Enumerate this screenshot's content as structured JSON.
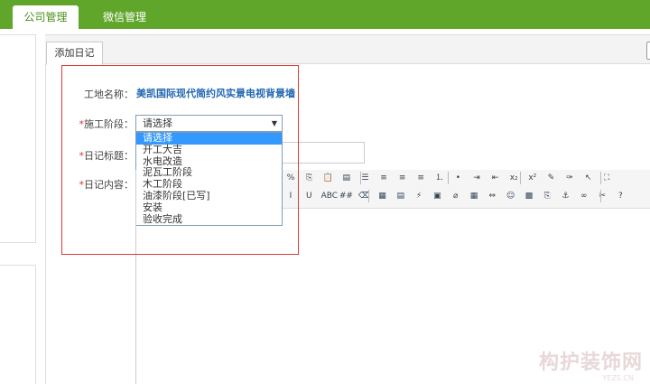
{
  "topnav": {
    "tab1": "公司管理",
    "tab2": "微信管理"
  },
  "subtab": "添加日记",
  "form": {
    "site_label": "工地名称：",
    "site_value": "美凯国际现代简约风实景电视背景墙",
    "stage_label": "施工阶段：",
    "title_label": "日记标题：",
    "content_label": "日记内容：",
    "required_mark": "*",
    "stage_selected": "请选择",
    "stage_options": [
      "请选择",
      "开工大吉",
      "水电改造",
      "泥瓦工阶段",
      "木工阶段",
      "油漆阶段[已写]",
      "安装",
      "验收完成"
    ]
  },
  "toolbar_icons": {
    "row1": [
      "copy-icon",
      "paste-icon",
      "paste-text-icon",
      "paste-word-icon",
      "align-left-icon",
      "align-center-icon",
      "align-right-icon",
      "justify-icon",
      "ordered-list-icon",
      "unordered-list-icon",
      "indent-icon",
      "outdent-icon",
      "subscript-icon",
      "superscript-icon",
      "clear-format-icon",
      "select-all-icon",
      "cursor-icon",
      "fullscreen-icon"
    ],
    "row2": [
      "italic-icon",
      "underline-icon",
      "strikethrough-icon",
      "hr-icon",
      "eraser-icon",
      "insert-image-icon",
      "insert-table-icon",
      "flash-icon",
      "media-icon",
      "attachment-icon",
      "table-icon",
      "link-icon",
      "emoticon-icon",
      "image-icon",
      "pagebreak-icon",
      "anchor-icon",
      "link2-icon",
      "unlink-icon",
      "help-icon"
    ]
  },
  "toolbar_glyphs": {
    "r1": [
      "%",
      "⎘",
      "📋",
      "▤",
      "☰",
      "≡",
      "≡",
      "≡",
      "⒈",
      "•",
      "⇥",
      "⇤",
      "x₂",
      "x²",
      "✎",
      "✑",
      "↖",
      "⛶"
    ],
    "r2": [
      "I",
      "U",
      "ABC",
      "##",
      "⌫",
      "▦",
      "▤",
      "⚡",
      "▣",
      "⌀",
      "▦",
      "⇔",
      "☺",
      "▩",
      "⎘",
      "⚓",
      "∞",
      "✂",
      "?"
    ]
  },
  "watermark": {
    "main": "构护装饰网",
    "sub": "YEZS.CN"
  },
  "colors": {
    "nav_green": "#5fa62a",
    "link_blue": "#2267b1",
    "highlight_red": "#e03a3a",
    "select_blue": "#3399ff"
  }
}
